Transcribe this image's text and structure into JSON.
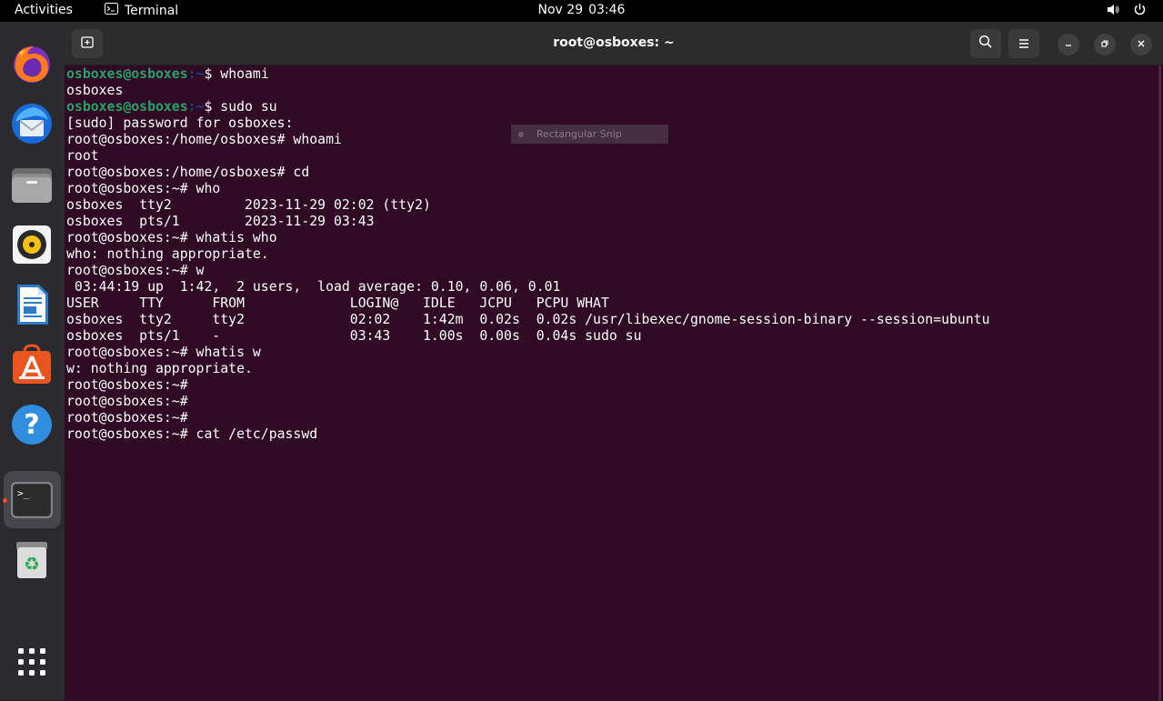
{
  "topbar": {
    "activities": "Activities",
    "app_name": "Terminal",
    "date": "Nov 29",
    "time": "03:46"
  },
  "dock": {
    "items": [
      "firefox-icon",
      "thunderbird-icon",
      "files-icon",
      "rhythmbox-icon",
      "libreoffice-writer-icon",
      "app-center-icon",
      "help-icon",
      "terminal-icon",
      "trash-icon",
      "show-apps-icon"
    ]
  },
  "window": {
    "title": "root@osboxes: ~"
  },
  "snip_overlay": {
    "label": "Rectangular Snip"
  },
  "terminal": {
    "user_prompt_user": "osboxes@osboxes",
    "user_prompt_path": ":~",
    "user_prompt_tail": "$ ",
    "lines": [
      {
        "kind": "user",
        "cmd": "whoami"
      },
      {
        "kind": "out",
        "text": "osboxes"
      },
      {
        "kind": "user",
        "cmd": "sudo su"
      },
      {
        "kind": "out",
        "text": "[sudo] password for osboxes:"
      },
      {
        "kind": "out",
        "text": "root@osboxes:/home/osboxes# whoami"
      },
      {
        "kind": "out",
        "text": "root"
      },
      {
        "kind": "out",
        "text": "root@osboxes:/home/osboxes# cd"
      },
      {
        "kind": "out",
        "text": "root@osboxes:~# who"
      },
      {
        "kind": "out",
        "text": "osboxes  tty2         2023-11-29 02:02 (tty2)"
      },
      {
        "kind": "out",
        "text": "osboxes  pts/1        2023-11-29 03:43"
      },
      {
        "kind": "out",
        "text": "root@osboxes:~# whatis who"
      },
      {
        "kind": "out",
        "text": "who: nothing appropriate."
      },
      {
        "kind": "out",
        "text": "root@osboxes:~# w"
      },
      {
        "kind": "out",
        "text": " 03:44:19 up  1:42,  2 users,  load average: 0.10, 0.06, 0.01"
      },
      {
        "kind": "out",
        "text": "USER     TTY      FROM             LOGIN@   IDLE   JCPU   PCPU WHAT"
      },
      {
        "kind": "out",
        "text": "osboxes  tty2     tty2             02:02    1:42m  0.02s  0.02s /usr/libexec/gnome-session-binary --session=ubuntu"
      },
      {
        "kind": "out",
        "text": "osboxes  pts/1    -                03:43    1.00s  0.00s  0.04s sudo su"
      },
      {
        "kind": "out",
        "text": "root@osboxes:~# whatis w"
      },
      {
        "kind": "out",
        "text": "w: nothing appropriate."
      },
      {
        "kind": "out",
        "text": "root@osboxes:~#"
      },
      {
        "kind": "out",
        "text": "root@osboxes:~#"
      },
      {
        "kind": "out",
        "text": "root@osboxes:~#"
      },
      {
        "kind": "out",
        "text": "root@osboxes:~# cat /etc/passwd"
      }
    ]
  },
  "colors": {
    "terminal_bg": "#300a24",
    "prompt_user": "#26a269",
    "prompt_path": "#12488b",
    "accent": "#e95420"
  }
}
